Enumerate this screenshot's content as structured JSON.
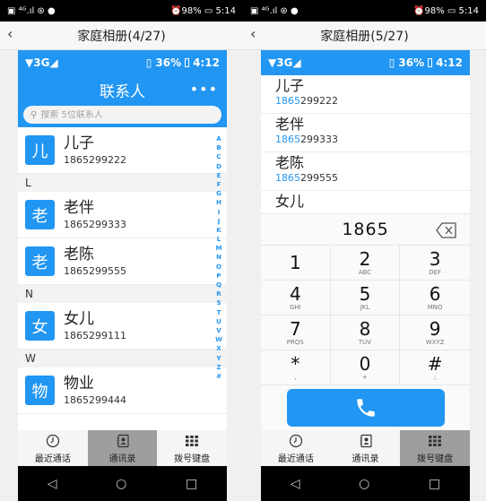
{
  "left": {
    "status": {
      "left_icons": "▣ ⁴ᴳ.ıl ⊛ ●",
      "right": "⏰98% ▭ 5:14"
    },
    "album_title": "家庭相册(4/27)",
    "inner_status": {
      "network": "▼3G◢",
      "battery": "36%",
      "time": "4:12"
    },
    "header_title": "联系人",
    "search_placeholder": "搜索 5位联系人",
    "sections": [
      {
        "letter": "",
        "contacts": [
          {
            "avatar": "儿",
            "name": "儿子",
            "phone": "1865299222"
          }
        ]
      },
      {
        "letter": "L",
        "contacts": [
          {
            "avatar": "老",
            "name": "老伴",
            "phone": "1865299333"
          },
          {
            "avatar": "老",
            "name": "老陈",
            "phone": "1865299555"
          }
        ]
      },
      {
        "letter": "N",
        "contacts": [
          {
            "avatar": "女",
            "name": "女儿",
            "phone": "1865299111"
          }
        ]
      },
      {
        "letter": "W",
        "contacts": [
          {
            "avatar": "物",
            "name": "物业",
            "phone": "1865299444"
          }
        ]
      }
    ],
    "index_letters": [
      "A",
      "B",
      "C",
      "D",
      "E",
      "F",
      "G",
      "H",
      "I",
      "J",
      "K",
      "L",
      "M",
      "N",
      "O",
      "P",
      "Q",
      "R",
      "S",
      "T",
      "U",
      "V",
      "W",
      "X",
      "Y",
      "Z",
      "#"
    ],
    "tabs": [
      {
        "label": "最近通话",
        "icon": "clock-icon",
        "active": false
      },
      {
        "label": "通讯录",
        "icon": "contacts-icon",
        "active": true
      },
      {
        "label": "拨号键盘",
        "icon": "keypad-icon",
        "active": false
      }
    ]
  },
  "right": {
    "status": {
      "left_icons": "▣ ⁴ᴳ.ıl ⊛ ●",
      "right": "⏰98% ▭ 5:14"
    },
    "album_title": "家庭相册(5/27)",
    "inner_status": {
      "network": "▼3G◢",
      "battery": "36%",
      "time": "4:12"
    },
    "matches": [
      {
        "name": "儿子",
        "phone_match": "1865",
        "phone_rest": "299222"
      },
      {
        "name": "老伴",
        "phone_match": "1865",
        "phone_rest": "299333"
      },
      {
        "name": "老陈",
        "phone_match": "1865",
        "phone_rest": "299555"
      },
      {
        "name": "女儿",
        "phone_match": "",
        "phone_rest": ""
      }
    ],
    "dialed": "1865",
    "keys": [
      {
        "d": "1",
        "l": ""
      },
      {
        "d": "2",
        "l": "ABC"
      },
      {
        "d": "3",
        "l": "DEF"
      },
      {
        "d": "4",
        "l": "GHI"
      },
      {
        "d": "5",
        "l": "JKL"
      },
      {
        "d": "6",
        "l": "MNO"
      },
      {
        "d": "7",
        "l": "PRQS"
      },
      {
        "d": "8",
        "l": "TUV"
      },
      {
        "d": "9",
        "l": "WXYZ"
      },
      {
        "d": "*",
        "l": ","
      },
      {
        "d": "0",
        "l": "+"
      },
      {
        "d": "#",
        "l": ";"
      }
    ],
    "tabs": [
      {
        "label": "最近通话",
        "icon": "clock-icon",
        "active": false
      },
      {
        "label": "通讯录",
        "icon": "contacts-icon",
        "active": false
      },
      {
        "label": "拨号键盘",
        "icon": "keypad-icon",
        "active": true
      }
    ]
  },
  "nav": {
    "back": "◁",
    "home": "○",
    "recent": "□"
  },
  "colors": {
    "accent": "#2196f3",
    "active_tab": "#9e9e9e"
  }
}
